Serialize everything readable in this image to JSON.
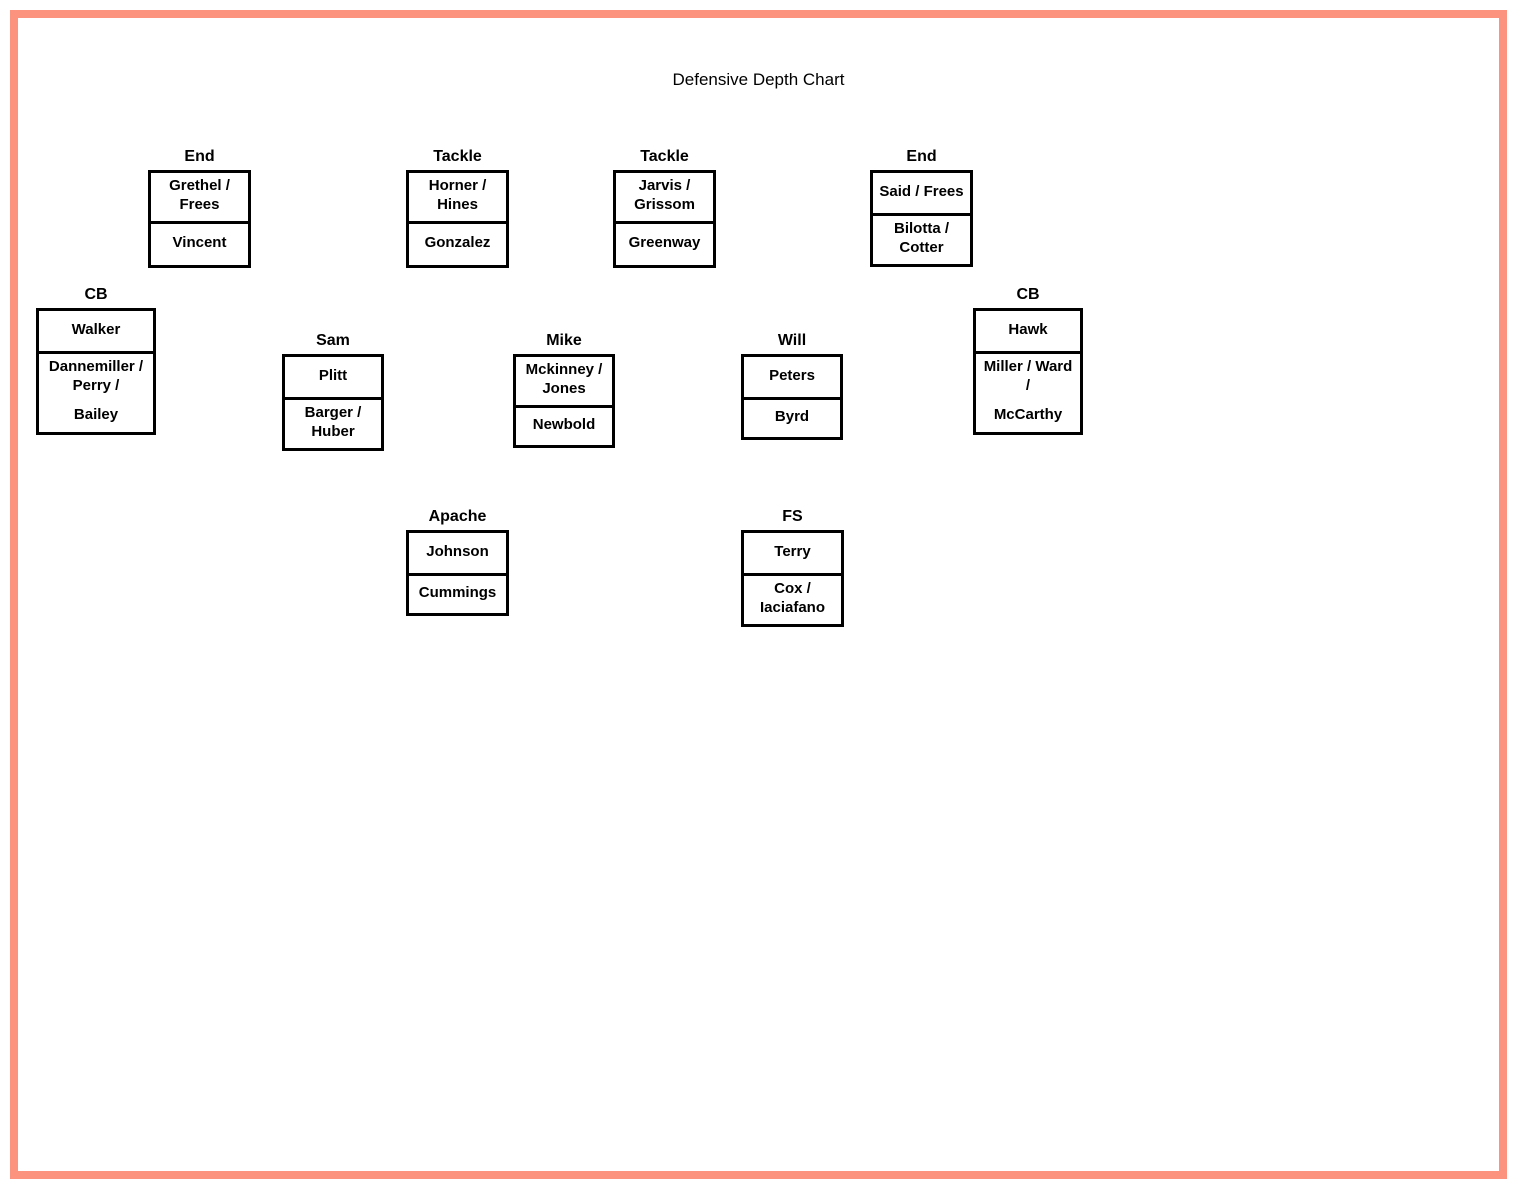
{
  "title": "Defensive Depth Chart",
  "positions": {
    "dl1": {
      "label": "End",
      "s1": "Grethel / Frees",
      "s2": "Vincent"
    },
    "dl2": {
      "label": "Tackle",
      "s1": "Horner / Hines",
      "s2": "Gonzalez"
    },
    "dl3": {
      "label": "Tackle",
      "s1": "Jarvis / Grissom",
      "s2": "Greenway"
    },
    "dl4": {
      "label": "End",
      "s1": "Said / Frees",
      "s2": "Bilotta / Cotter"
    },
    "cb1": {
      "label": "CB",
      "s1": "Walker",
      "s2": "Dannemiller / Perry /",
      "s3": "Bailey"
    },
    "sam": {
      "label": "Sam",
      "s1": "Plitt",
      "s2": "Barger / Huber"
    },
    "mike": {
      "label": "Mike",
      "s1": "Mckinney / Jones",
      "s2": "Newbold"
    },
    "will": {
      "label": "Will",
      "s1": "Peters",
      "s2": "Byrd"
    },
    "cb2": {
      "label": "CB",
      "s1": "Hawk",
      "s2": "Miller / Ward /",
      "s3": "McCarthy"
    },
    "apache": {
      "label": "Apache",
      "s1": "Johnson",
      "s2": "Cummings"
    },
    "fs": {
      "label": "FS",
      "s1": "Terry",
      "s2": "Cox / Iaciafano"
    }
  }
}
